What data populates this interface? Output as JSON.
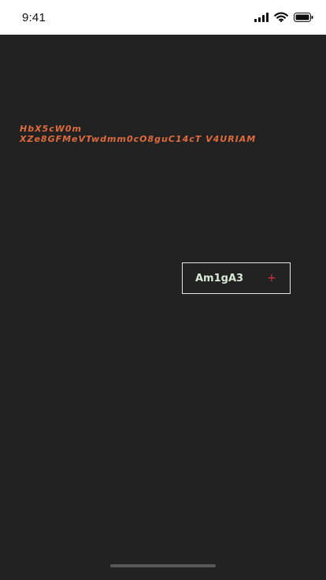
{
  "status_bar": {
    "time": "9:41",
    "icons": [
      "signal-icon",
      "wifi-icon",
      "battery-icon"
    ]
  },
  "content": {
    "text_lines": [
      "HbX5cW0m",
      "XZe8GFMeVTwdmm0cO8guC14cT V4URIAM"
    ],
    "button": {
      "label": "Am1gA3",
      "icon": "plus-icon",
      "icon_glyph": "+"
    }
  },
  "colors": {
    "background": "#222222",
    "status_bar": "#ffffff",
    "accent_text": "#df6b3f",
    "button_text": "#d8ead6",
    "button_border": "#e6e6e6",
    "plus": "#d7353b"
  }
}
